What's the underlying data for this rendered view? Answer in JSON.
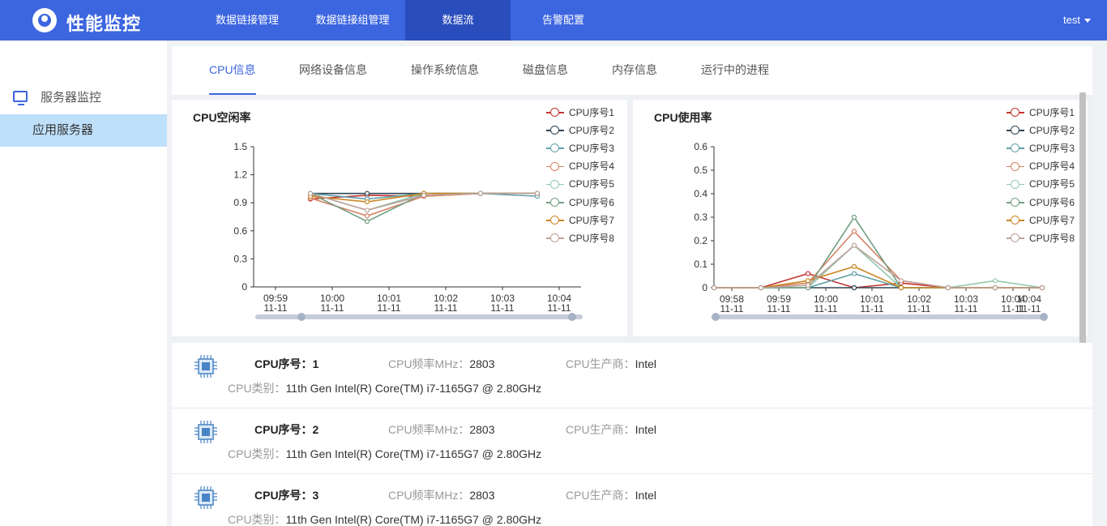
{
  "app": {
    "title": "性能监控",
    "user": "test"
  },
  "nav": [
    {
      "label": "数据链接管理",
      "active": false
    },
    {
      "label": "数据链接组管理",
      "active": false
    },
    {
      "label": "数据流",
      "active": true
    },
    {
      "label": "告警配置",
      "active": false
    }
  ],
  "sidebar": {
    "group": "服务器监控",
    "items": [
      {
        "label": "应用服务器",
        "active": true
      }
    ]
  },
  "tabs": [
    {
      "label": "CPU信息",
      "active": true
    },
    {
      "label": "网络设备信息",
      "active": false
    },
    {
      "label": "操作系统信息",
      "active": false
    },
    {
      "label": "磁盘信息",
      "active": false
    },
    {
      "label": "内存信息",
      "active": false
    },
    {
      "label": "运行中的进程",
      "active": false
    }
  ],
  "colors": {
    "brand": "#3c65e0",
    "series": [
      "#c23531",
      "#2f4554",
      "#61a0a8",
      "#d48265",
      "#91c7ae",
      "#749f83",
      "#ca8622",
      "#bda29a"
    ]
  },
  "chart_data": [
    {
      "type": "line",
      "title": "CPU空闲率",
      "legend_position": "top-right",
      "ylim": [
        0,
        1.5
      ],
      "yticks": [
        "1.5",
        "1.2",
        "0.9",
        "0.6",
        "0.3",
        "0"
      ],
      "xticks": [
        [
          "09:59",
          "11-11"
        ],
        [
          "10:00",
          "11-11"
        ],
        [
          "10:01",
          "11-11"
        ],
        [
          "10:02",
          "11-11"
        ],
        [
          "10:03",
          "11-11"
        ],
        [
          "10:04",
          "11-11"
        ]
      ],
      "series": [
        {
          "name": "CPU序号1",
          "values": [
            0.94,
            0.98,
            0.97,
            1.0,
            1.0
          ]
        },
        {
          "name": "CPU序号2",
          "values": [
            1.0,
            1.0,
            1.0,
            1.0,
            1.0
          ]
        },
        {
          "name": "CPU序号3",
          "values": [
            1.0,
            0.94,
            1.0,
            1.0,
            0.97
          ]
        },
        {
          "name": "CPU序号4",
          "values": [
            0.95,
            0.76,
            0.97,
            1.0,
            1.0
          ]
        },
        {
          "name": "CPU序号5",
          "values": [
            1.0,
            0.82,
            1.0,
            1.0,
            1.0
          ]
        },
        {
          "name": "CPU序号6",
          "values": [
            1.0,
            0.7,
            1.0,
            1.0,
            1.0
          ]
        },
        {
          "name": "CPU序号7",
          "values": [
            0.97,
            0.91,
            1.0,
            1.0,
            1.0
          ]
        },
        {
          "name": "CPU序号8",
          "values": [
            1.0,
            0.82,
            0.98,
            1.0,
            1.0
          ]
        }
      ]
    },
    {
      "type": "line",
      "title": "CPU使用率",
      "legend_position": "top-right",
      "ylim": [
        0,
        0.6
      ],
      "yticks": [
        "0.6",
        "0.5",
        "0.4",
        "0.3",
        "0.2",
        "0.1",
        "0"
      ],
      "xticks": [
        [
          "09:58",
          "11-11"
        ],
        [
          "09:59",
          "11-11"
        ],
        [
          "10:00",
          "11-11"
        ],
        [
          "10:01",
          "11-11"
        ],
        [
          "10:02",
          "11-11"
        ],
        [
          "10:03",
          "11-11"
        ],
        [
          "10:04",
          "11-11"
        ],
        [
          "10:04",
          "11-11"
        ]
      ],
      "series": [
        {
          "name": "CPU序号1",
          "values": [
            0,
            0,
            0.06,
            0,
            0.02,
            0,
            0,
            0
          ]
        },
        {
          "name": "CPU序号2",
          "values": [
            0,
            0,
            0,
            0,
            0,
            0,
            0,
            0
          ]
        },
        {
          "name": "CPU序号3",
          "values": [
            0,
            0,
            0,
            0.06,
            0,
            0,
            0,
            0
          ]
        },
        {
          "name": "CPU序号4",
          "values": [
            0,
            0,
            0.02,
            0.24,
            0.03,
            0,
            0,
            0
          ]
        },
        {
          "name": "CPU序号5",
          "values": [
            0,
            0,
            0,
            0.18,
            0,
            0,
            0.03,
            0
          ]
        },
        {
          "name": "CPU序号6",
          "values": [
            0,
            0,
            0,
            0.3,
            0,
            0,
            0,
            0
          ]
        },
        {
          "name": "CPU序号7",
          "values": [
            0,
            0,
            0.03,
            0.09,
            0,
            0,
            0,
            0
          ]
        },
        {
          "name": "CPU序号8",
          "values": [
            0,
            0,
            0.01,
            0.18,
            0.03,
            0,
            0,
            0
          ]
        }
      ]
    }
  ],
  "cpu_list": [
    {
      "num_label": "CPU序号：1",
      "freq_key": "CPU频率MHz：",
      "freq": "2803",
      "vendor_key": "CPU生产商：",
      "vendor": "Intel",
      "type_key": "CPU类别：",
      "type": "11th Gen Intel(R) Core(TM) i7-1165G7 @ 2.80GHz"
    },
    {
      "num_label": "CPU序号：2",
      "freq_key": "CPU频率MHz：",
      "freq": "2803",
      "vendor_key": "CPU生产商：",
      "vendor": "Intel",
      "type_key": "CPU类别：",
      "type": "11th Gen Intel(R) Core(TM) i7-1165G7 @ 2.80GHz"
    },
    {
      "num_label": "CPU序号：3",
      "freq_key": "CPU频率MHz：",
      "freq": "2803",
      "vendor_key": "CPU生产商：",
      "vendor": "Intel",
      "type_key": "CPU类别：",
      "type": "11th Gen Intel(R) Core(TM) i7-1165G7 @ 2.80GHz"
    }
  ]
}
